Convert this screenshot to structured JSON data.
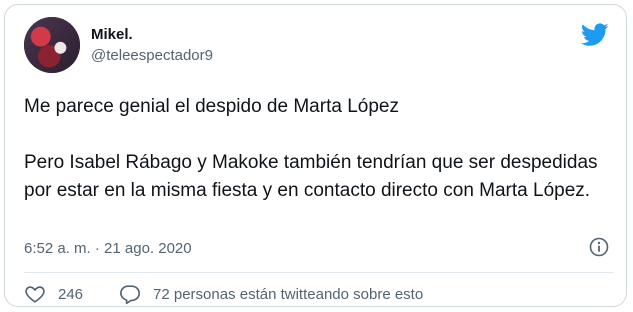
{
  "author": {
    "display_name": "Mikel.",
    "handle": "@teleespectador9"
  },
  "tweet": {
    "lines": [
      "Me parece genial el despido de Marta López",
      "Pero Isabel Rábago y Makoke también tendrían que ser despedidas por estar en la misma fiesta y en contacto directo con Marta López."
    ],
    "timestamp": "6:52 a. m. · 21 ago. 2020"
  },
  "actions": {
    "like_count": "246",
    "reply_text": "72 personas están twitteando sobre esto"
  },
  "icons": {
    "brand": "twitter-bird-icon",
    "info": "info-icon",
    "like": "heart-icon",
    "reply": "speech-bubble-icon"
  },
  "colors": {
    "brand": "#1d9bf0",
    "text": "#0f1419",
    "muted": "#536471",
    "border": "#cfd9de"
  }
}
